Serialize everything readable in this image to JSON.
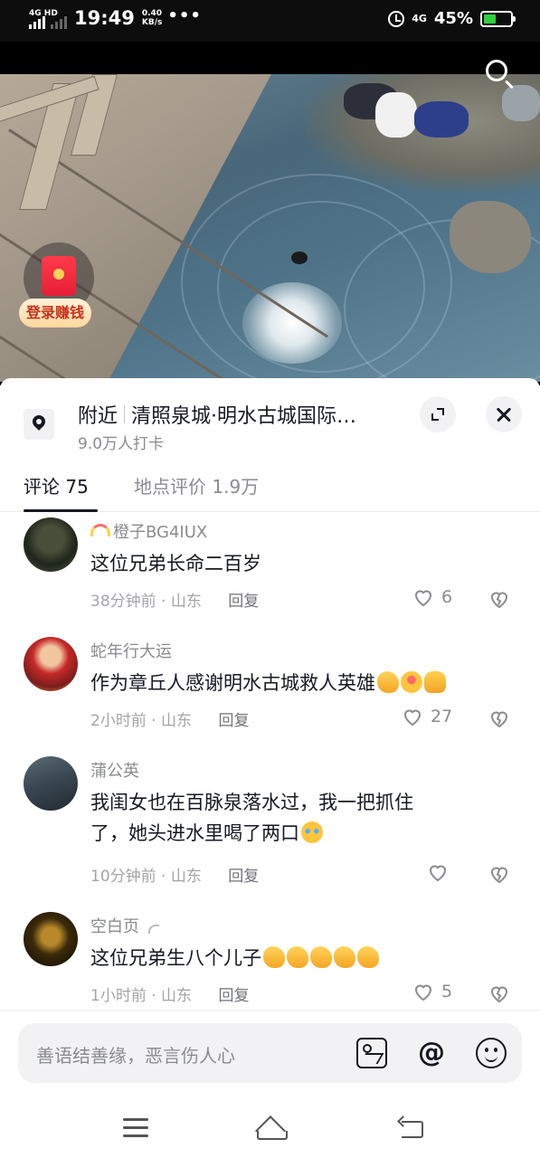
{
  "status_bar": {
    "network": "4G HD",
    "time": "19:49",
    "speed_value": "0.40",
    "speed_unit": "KB/s",
    "dots": "•••",
    "network_right": "4G",
    "battery_percent": "45%",
    "battery_level": 0.45,
    "battery_color": "#2ed13a"
  },
  "video": {
    "login_earn_label": "登录赚钱"
  },
  "location": {
    "nearby_label": "附近",
    "place_name": "清照泉城·明水古城国际…",
    "checkins": "9.0万人打卡"
  },
  "tabs": [
    {
      "label": "评论 75",
      "active": true
    },
    {
      "label": "地点评价 1.9万",
      "active": false
    }
  ],
  "comments": [
    {
      "user": "橙子BG4IUX",
      "text": "这位兄弟长命二百岁",
      "time": "38分钟前",
      "region": "山东",
      "reply_label": "回复",
      "likes": "6"
    },
    {
      "user": "蛇年行大运",
      "text": "作为章丘人感谢明水古城救人英雄",
      "time": "2小时前",
      "region": "山东",
      "reply_label": "回复",
      "likes": "27"
    },
    {
      "user": "蒲公英",
      "text_line1": "我闺女也在百脉泉落水过，我一把抓住",
      "text_line2": "了，她头进水里喝了两口",
      "time": "10分钟前",
      "region": "山东",
      "reply_label": "回复",
      "likes": ""
    },
    {
      "user": "空白页",
      "text": "这位兄弟生八个儿子",
      "time": "1小时前",
      "region": "山东",
      "reply_label": "回复",
      "likes": "5"
    }
  ],
  "meta_separator": " · ",
  "input": {
    "placeholder": "善语结善缘，恶言伤人心",
    "at_symbol": "@"
  },
  "colors": {
    "accent_red": "#e61e36",
    "text_primary": "#161823",
    "text_secondary": "#8a8b91"
  }
}
